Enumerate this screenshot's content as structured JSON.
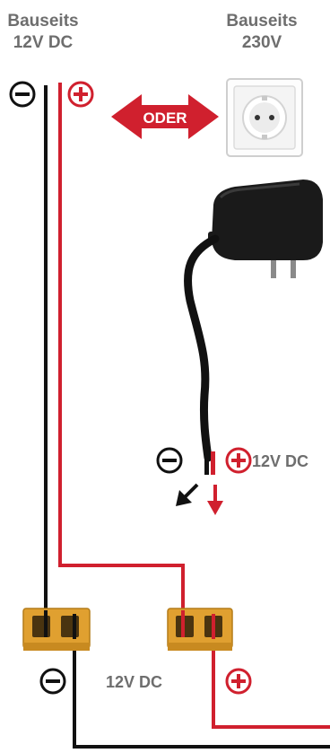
{
  "left_source": {
    "line1": "Bauseits",
    "line2": "12V DC"
  },
  "right_source": {
    "line1": "Bauseits",
    "line2": "230V"
  },
  "oder_label": "ODER",
  "adapter_output_label": "12V DC",
  "bottom_label": "12V DC",
  "colors": {
    "red": "#d0202e",
    "black": "#111111",
    "gray_text": "#6e6e6e",
    "terminal_orange": "#e0a030"
  },
  "icons": {
    "minus": "minus-circle-icon",
    "plus": "plus-circle-icon",
    "socket": "wall-socket-icon",
    "adapter": "power-adapter-icon"
  }
}
